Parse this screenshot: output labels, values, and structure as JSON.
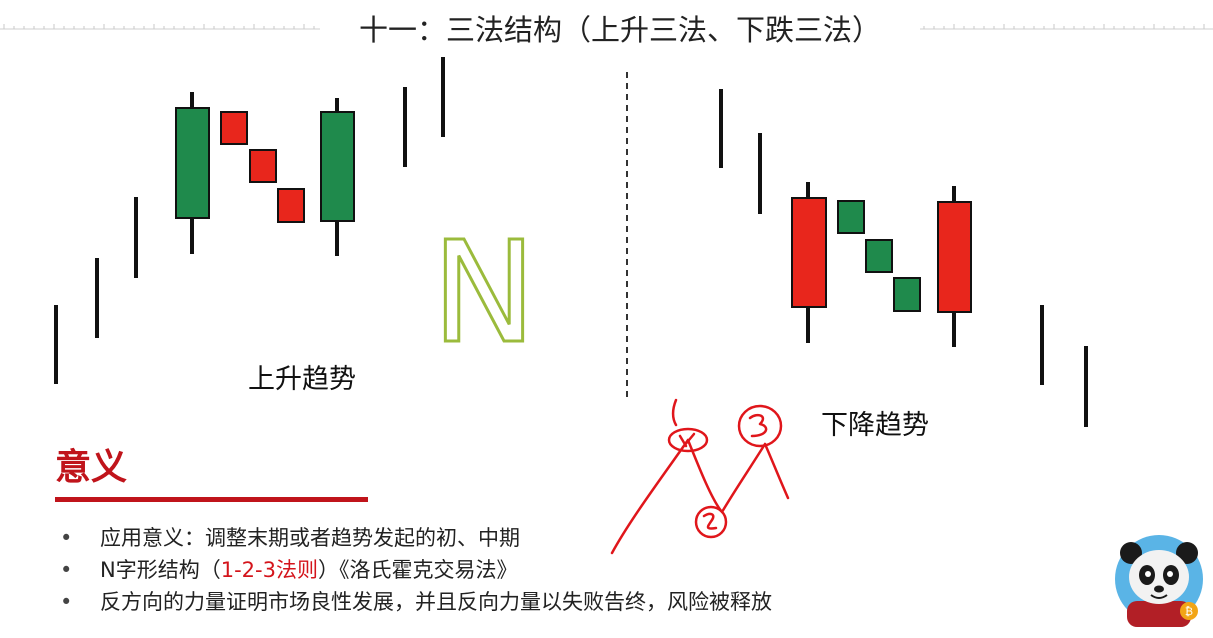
{
  "slide": {
    "title": "十一：三法结构（上升三法、下跌三法）"
  },
  "diagram": {
    "up_trend_label": "上升趋势",
    "down_trend_label": "下降趋势",
    "n_letter": "N",
    "colors": {
      "bull": "#1f8a4c",
      "bear": "#e8261c",
      "wick": "#111111",
      "n_letter": "#9bbb3c",
      "handwriting": "#e0161b"
    }
  },
  "meaning": {
    "heading": "意义",
    "bullet_symbol": "•",
    "bullets": {
      "b1": "应用意义：调整末期或者趋势发起的初、中期",
      "b2_pre": "N字形结构（",
      "b2_red": "1-2-3法则",
      "b2_post": "）《洛氏霍克交易法》",
      "b3": "反方向的力量证明市场良性发展，并且反向力量以失败告终，风险被释放"
    }
  },
  "colors": {
    "accent_red": "#c0141b",
    "text": "#222222"
  }
}
